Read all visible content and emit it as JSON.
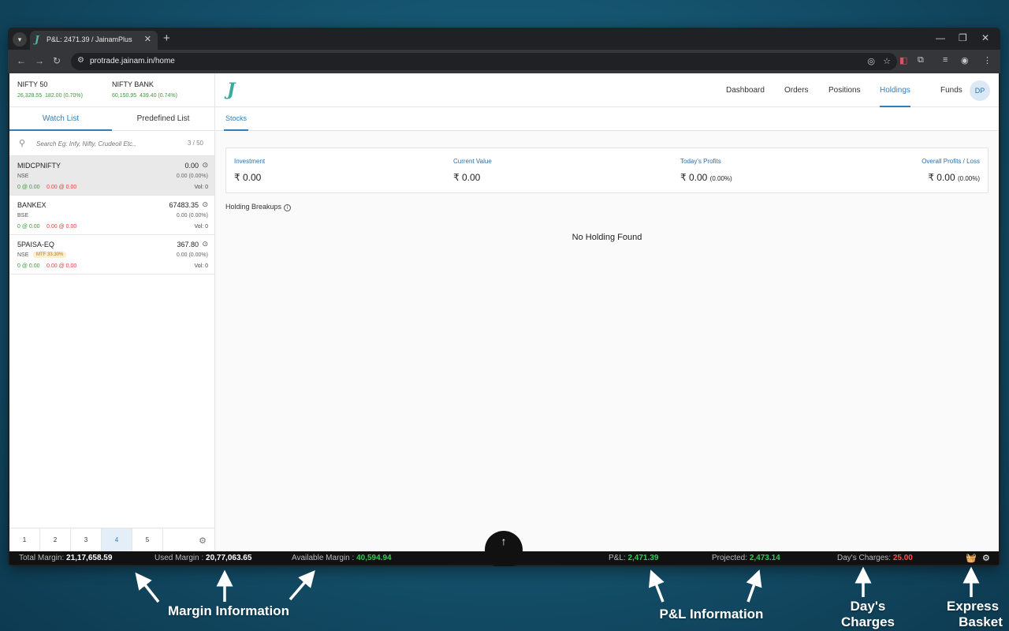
{
  "browser": {
    "tab_title": "P&L: 2471.39 / JainamPlus",
    "url": "protrade.jainam.in/home"
  },
  "indices": [
    {
      "name": "NIFTY 50",
      "value": "26,328.55",
      "change": "182.00 (0.70%)"
    },
    {
      "name": "NIFTY BANK",
      "value": "60,150.95",
      "change": "439.40 (0.74%)"
    }
  ],
  "watchlist_tabs": [
    "Watch List",
    "Predefined List"
  ],
  "search": {
    "placeholder": "Search Eg: Infy, Nifty, Crudeoil Etc.,",
    "count": "3 / 50"
  },
  "watchlist": [
    {
      "symbol": "MIDCPNIFTY",
      "price": "0.00",
      "exchange": "NSE",
      "tag": "",
      "change": "0.00 (0.00%)",
      "bid": "0 @ 0.00",
      "ask": "0.00 @ 0.00",
      "vol": "Vol: 0"
    },
    {
      "symbol": "BANKEX",
      "price": "67483.35",
      "exchange": "BSE",
      "tag": "",
      "change": "0.00 (0.00%)",
      "bid": "0 @ 0.00",
      "ask": "0.00 @ 0.00",
      "vol": "Vol: 0"
    },
    {
      "symbol": "5PAISA-EQ",
      "price": "367.80",
      "exchange": "NSE",
      "tag": "MTF 33.30%",
      "change": "0.00 (0.00%)",
      "bid": "0 @ 0.00",
      "ask": "0.00 @ 0.00",
      "vol": "Vol: 0"
    }
  ],
  "pages": [
    "1",
    "2",
    "3",
    "4",
    "5"
  ],
  "nav": [
    "Dashboard",
    "Orders",
    "Positions",
    "Holdings",
    "Funds"
  ],
  "user_initials": "DP",
  "subtab": "Stocks",
  "summary": {
    "investment_label": "Investment",
    "investment_value": "₹ 0.00",
    "current_label": "Current Value",
    "current_value": "₹ 0.00",
    "today_label": "Today's Profits",
    "today_value": "₹ 0.00",
    "today_pct": "(0.00%)",
    "overall_label": "Overall Profits / Loss",
    "overall_value": "₹ 0.00",
    "overall_pct": "(0.00%)"
  },
  "breakups_label": "Holding Breakups",
  "empty_message": "No Holding Found",
  "status": {
    "total_margin_label": "Total Margin:",
    "total_margin": "21,17,658.59",
    "used_margin_label": "Used Margin :",
    "used_margin": "20,77,063.65",
    "available_margin_label": "Available Margin :",
    "available_margin": "40,594.94",
    "pnl_label": "P&L:",
    "pnl": "2,471.39",
    "projected_label": "Projected:",
    "projected": "2,473.14",
    "charges_label": "Day's Charges:",
    "charges": "25.00"
  },
  "annotations": {
    "margin": "Margin Information",
    "pnl": "P&L Information",
    "charges_line1": "Day's",
    "charges_line2": "Charges",
    "basket_line1": "Express",
    "basket_line2": "Basket"
  },
  "colors": {
    "accent": "#2f7fbd",
    "profit": "#34c759",
    "loss": "#ff4d4d",
    "background": "#14506a"
  }
}
